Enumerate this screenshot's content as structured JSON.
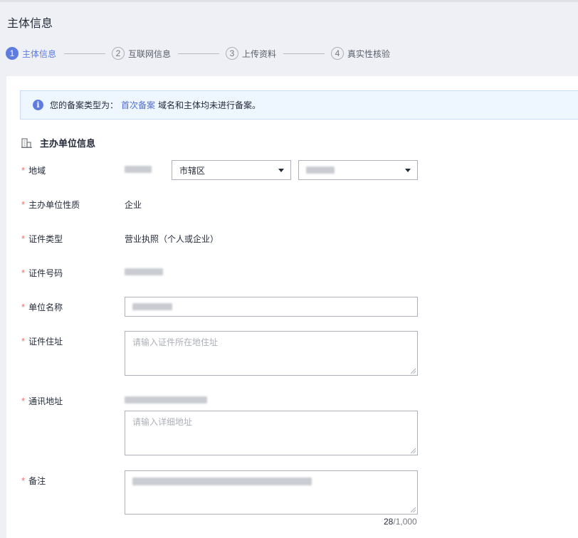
{
  "page": {
    "title": "主体信息"
  },
  "steps": [
    {
      "num": "1",
      "label": "主体信息",
      "active": true
    },
    {
      "num": "2",
      "label": "互联网信息",
      "active": false
    },
    {
      "num": "3",
      "label": "上传资料",
      "active": false
    },
    {
      "num": "4",
      "label": "真实性核验",
      "active": false
    }
  ],
  "notice": {
    "icon": "info-icon",
    "prefix": "您的备案类型为：",
    "link": "首次备案",
    "suffix": "域名和主体均未进行备案。"
  },
  "section": {
    "icon": "building-icon",
    "title": "主办单位信息"
  },
  "required_mark": "*",
  "fields": {
    "region": {
      "label": "地域",
      "city_select": "市辖区"
    },
    "unit_nature": {
      "label": "主办单位性质",
      "value": "企业"
    },
    "cert_type": {
      "label": "证件类型",
      "value": "营业执照（个人或企业）"
    },
    "cert_number": {
      "label": "证件号码"
    },
    "unit_name": {
      "label": "单位名称"
    },
    "cert_address": {
      "label": "证件住址",
      "placeholder": "请输入证件所在地住址"
    },
    "mail_address": {
      "label": "通讯地址",
      "placeholder": "请输入详细地址"
    },
    "remark": {
      "label": "备注",
      "count": "28",
      "max": "/1,000"
    }
  },
  "colors": {
    "accent": "#5e7ce0",
    "required": "#f66f6a",
    "notice_bg": "#eef6ff"
  }
}
